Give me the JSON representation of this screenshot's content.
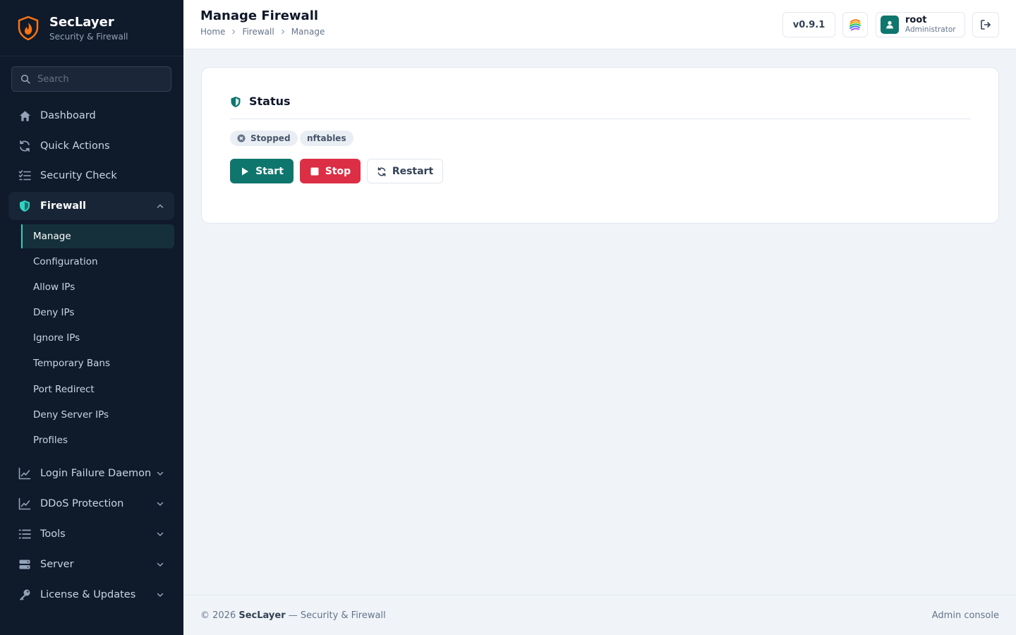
{
  "brand": {
    "title": "SecLayer",
    "subtitle": "Security & Firewall"
  },
  "search": {
    "placeholder": "Search"
  },
  "sidebar": {
    "items": [
      {
        "label": "Dashboard",
        "icon": "home-icon"
      },
      {
        "label": "Quick Actions",
        "icon": "refresh-icon"
      },
      {
        "label": "Security Check",
        "icon": "checklist-icon"
      },
      {
        "label": "Firewall",
        "icon": "shield-icon",
        "expanded": true
      },
      {
        "label": "Login Failure Daemon",
        "icon": "chart-icon"
      },
      {
        "label": "DDoS Protection",
        "icon": "chart-icon"
      },
      {
        "label": "Tools",
        "icon": "list-icon"
      },
      {
        "label": "Server",
        "icon": "server-icon"
      },
      {
        "label": "License & Updates",
        "icon": "key-icon"
      }
    ],
    "firewall_sub": [
      "Manage",
      "Configuration",
      "Allow IPs",
      "Deny IPs",
      "Ignore IPs",
      "Temporary Bans",
      "Port Redirect",
      "Deny Server IPs",
      "Profiles"
    ],
    "active_sub": "Manage"
  },
  "header": {
    "title": "Manage Firewall",
    "breadcrumb": [
      "Home",
      "Firewall",
      "Manage"
    ],
    "version": "v0.9.1",
    "user": {
      "name": "root",
      "role": "Administrator"
    }
  },
  "status_card": {
    "title": "Status",
    "badges": {
      "state": "Stopped",
      "backend": "nftables"
    },
    "buttons": {
      "start": "Start",
      "stop": "Stop",
      "restart": "Restart"
    }
  },
  "footer": {
    "copyright": "© 2026",
    "brand": "SecLayer",
    "tagline": "— Security & Firewall",
    "right": "Admin console"
  },
  "colors": {
    "sidebar_bg": "#0f1a2b",
    "accent": "#0f766e",
    "danger": "#dc2f45",
    "brand_orange": "#f97316",
    "active_border": "#2dd4bf"
  }
}
